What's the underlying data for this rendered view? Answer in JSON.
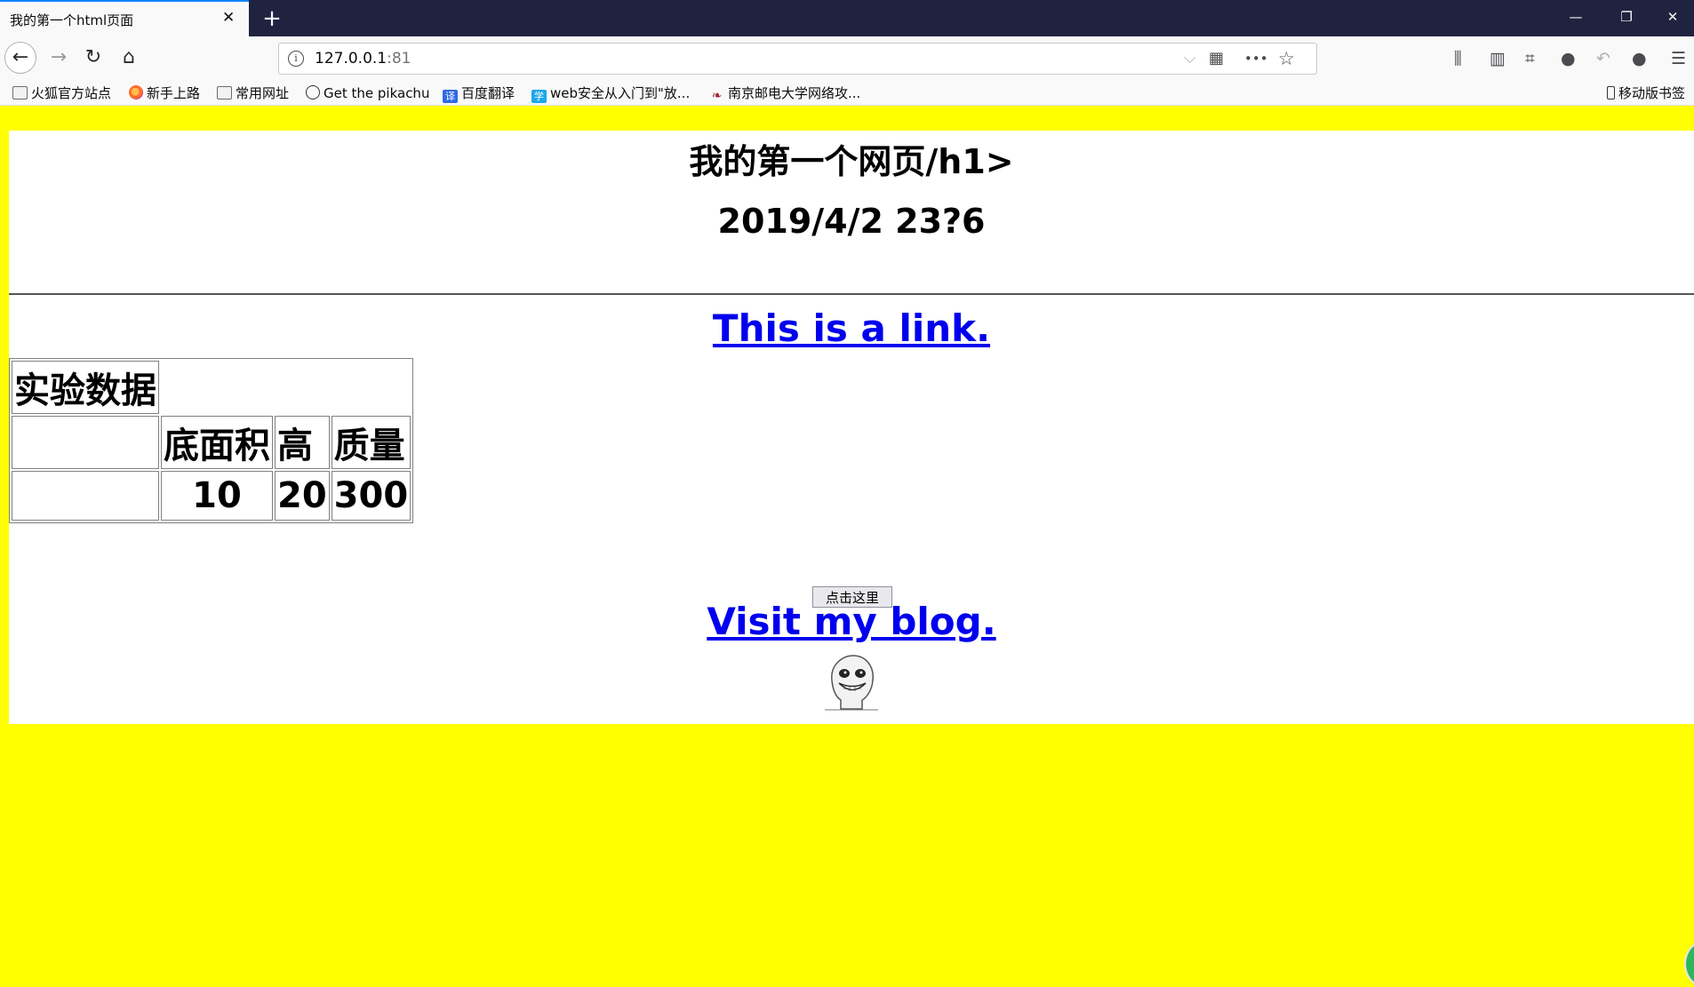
{
  "browser": {
    "tab_title": "我的第一个html页面",
    "tab_close": "✕",
    "new_tab": "+",
    "window_controls": {
      "minimize": "—",
      "restore": "❐",
      "close": "✕"
    },
    "nav": {
      "back": "←",
      "forward": "→",
      "reload": "↻",
      "home": "⌂"
    },
    "url": {
      "host": "127.0.0.1",
      "port": ":81"
    },
    "url_actions": {
      "qr": "▦",
      "more": "•••",
      "star": "☆",
      "dropdown": "⌵"
    },
    "toolbar": {
      "library": "⫼",
      "sidebar": "▥",
      "screenshot": "⌗",
      "chat": "●",
      "undo": "↶",
      "profile": "●",
      "menu": "☰"
    }
  },
  "bookmarks": {
    "items": [
      {
        "label": "火狐官方站点",
        "icon": "folder-icon"
      },
      {
        "label": "新手上路",
        "icon": "firefox-icon"
      },
      {
        "label": "常用网址",
        "icon": "folder-icon"
      },
      {
        "label": "Get the pikachu",
        "icon": "globe-icon"
      },
      {
        "label": "百度翻译",
        "icon": "baidu-translate-icon",
        "glyph": "译"
      },
      {
        "label": "web安全从入门到\"放...",
        "icon": "study-icon",
        "glyph": "学"
      },
      {
        "label": "南京邮电大学网络攻...",
        "icon": "njupt-icon",
        "glyph": "❧"
      }
    ],
    "mobile": "移动版书签"
  },
  "page": {
    "heading1": "我的第一个网页/h1>",
    "heading2": "2019/4/2 23?6",
    "link1": "This is a link.",
    "table": {
      "caption": "实验数据",
      "headers": [
        "",
        "底面积",
        "高",
        "质量"
      ],
      "row": [
        "",
        "10",
        "20",
        "300"
      ]
    },
    "button": "点击这里",
    "link2": "Visit my blog."
  },
  "colors": {
    "page_background": "#ffff00",
    "content_background": "#ffffff",
    "link": "#0000ee",
    "tabstrip": "#202340",
    "active_tab_accent": "#0a84ff"
  }
}
